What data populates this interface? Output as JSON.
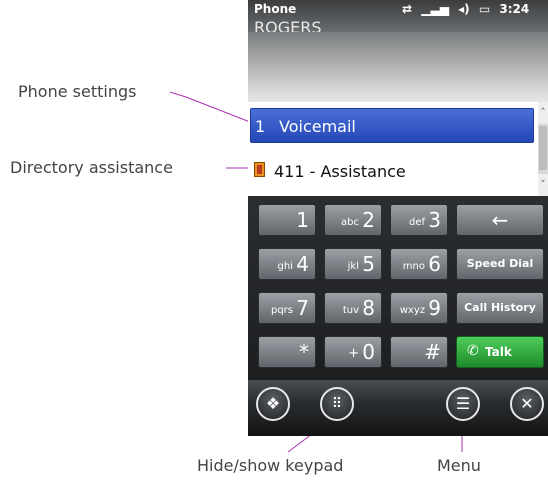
{
  "annotations": {
    "phone_settings": "Phone settings",
    "directory_assistance": "Directory assistance",
    "hide_show_keypad": "Hide/show keypad",
    "menu": "Menu"
  },
  "statusbar": {
    "title": "Phone",
    "time": "3:24",
    "icons": [
      "sync-icon",
      "signal-icon",
      "speaker-icon",
      "battery-icon"
    ]
  },
  "carrier": "ROGERS",
  "list": {
    "items": [
      {
        "number": "1",
        "label": "Voicemail",
        "selected": true
      },
      {
        "label": "411 - Assistance",
        "icon": "address-book-icon"
      }
    ]
  },
  "keypad": {
    "keys": [
      {
        "digit": "1",
        "letters": ""
      },
      {
        "digit": "2",
        "letters": "abc"
      },
      {
        "digit": "3",
        "letters": "def"
      },
      {
        "digit": "4",
        "letters": "ghi"
      },
      {
        "digit": "5",
        "letters": "jkl"
      },
      {
        "digit": "6",
        "letters": "mno"
      },
      {
        "digit": "7",
        "letters": "pqrs"
      },
      {
        "digit": "8",
        "letters": "tuv"
      },
      {
        "digit": "9",
        "letters": "wxyz"
      },
      {
        "digit": "*",
        "letters": ""
      },
      {
        "digit": "0",
        "letters": "+"
      },
      {
        "digit": "#",
        "letters": ""
      }
    ],
    "backspace": "←",
    "speed_dial": "Speed Dial",
    "call_history": "Call History",
    "talk": "Talk"
  },
  "softkeys": [
    "windows-start-icon",
    "keypad-toggle-icon",
    "menu-icon",
    "close-icon"
  ],
  "colors": {
    "selection": "#2f55c8",
    "talk": "#2fa63b",
    "callout_line": "#b02fb0"
  }
}
